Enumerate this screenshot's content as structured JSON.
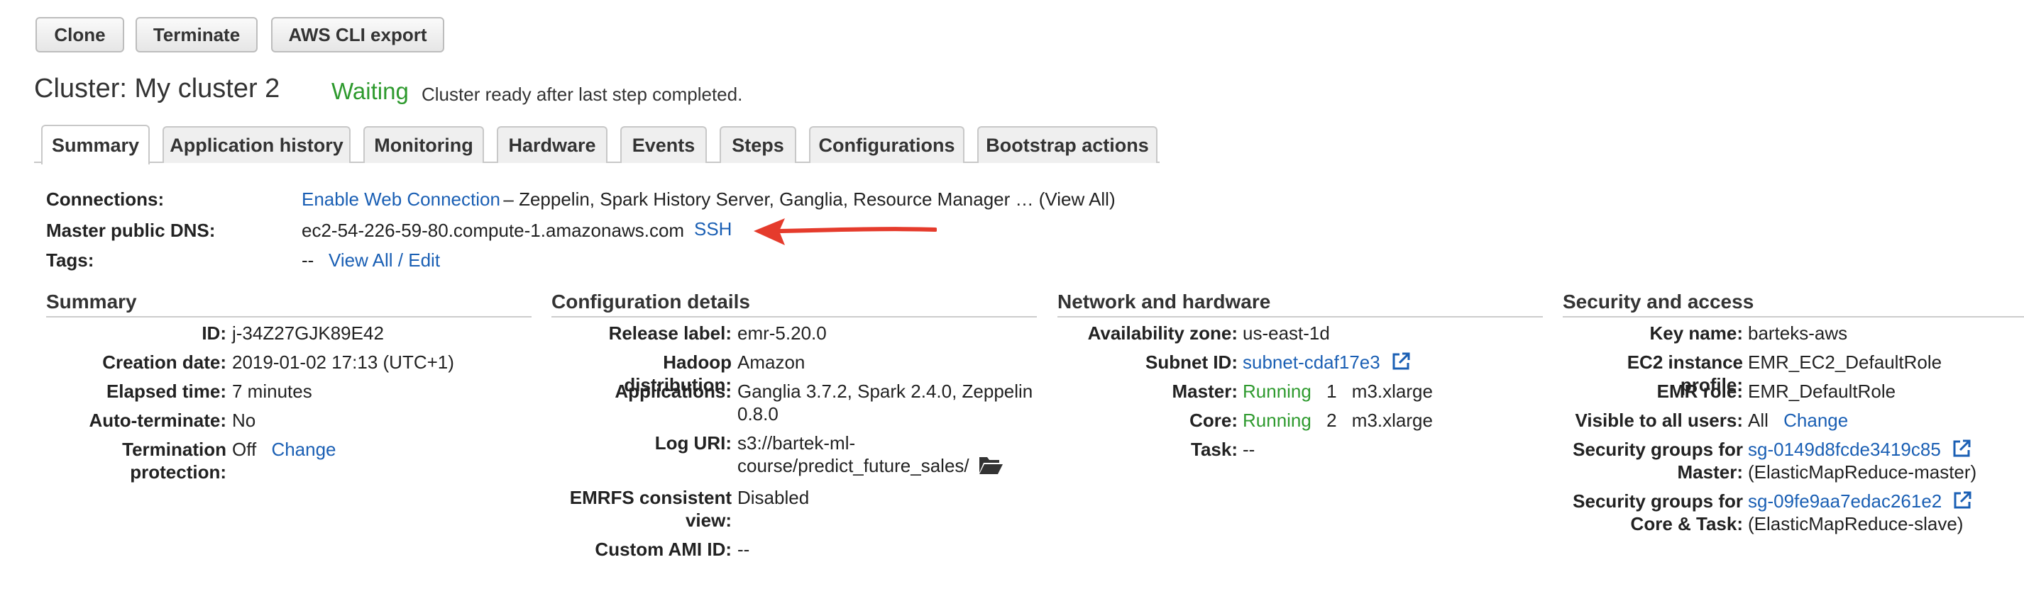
{
  "toolbar": {
    "clone_label": "Clone",
    "terminate_label": "Terminate",
    "cli_export_label": "AWS CLI export"
  },
  "cluster": {
    "title": "Cluster: My cluster 2",
    "status": "Waiting",
    "status_message": "Cluster ready after last step completed."
  },
  "tabs": [
    {
      "label": "Summary",
      "active": true
    },
    {
      "label": "Application history"
    },
    {
      "label": "Monitoring"
    },
    {
      "label": "Hardware"
    },
    {
      "label": "Events"
    },
    {
      "label": "Steps"
    },
    {
      "label": "Configurations"
    },
    {
      "label": "Bootstrap actions"
    }
  ],
  "overview": {
    "connections_label": "Connections:",
    "connections_link": "Enable Web Connection",
    "connections_text": "– Zeppelin, Spark History Server, Ganglia, Resource Manager … (View All)",
    "dns_label": "Master public DNS:",
    "dns_value": "ec2-54-226-59-80.compute-1.amazonaws.com",
    "ssh_link": "SSH",
    "tags_label": "Tags:",
    "tags_value": "--",
    "tags_link": "View All / Edit"
  },
  "summary": {
    "heading": "Summary",
    "id_label": "ID:",
    "id_value": "j-34Z27GJK89E42",
    "created_label": "Creation date:",
    "created_value": "2019-01-02 17:13 (UTC+1)",
    "elapsed_label": "Elapsed time:",
    "elapsed_value": "7 minutes",
    "autoterm_label": "Auto-terminate:",
    "autoterm_value": "No",
    "termprot_label": "Termination protection:",
    "termprot_value": "Off",
    "termprot_link": "Change"
  },
  "config": {
    "heading": "Configuration details",
    "release_label": "Release label:",
    "release_value": "emr-5.20.0",
    "hadoop_label": "Hadoop distribution:",
    "hadoop_value": "Amazon",
    "apps_label": "Applications:",
    "apps_line1": "Ganglia 3.7.2, Spark 2.4.0, Zeppelin",
    "apps_line2": "0.8.0",
    "log_label": "Log URI:",
    "log_line1": "s3://bartek-ml-",
    "log_line2": "course/predict_future_sales/",
    "emrfs_label": "EMRFS consistent view:",
    "emrfs_value": "Disabled",
    "ami_label": "Custom AMI ID:",
    "ami_value": "--"
  },
  "network": {
    "heading": "Network and hardware",
    "az_label": "Availability zone:",
    "az_value": "us-east-1d",
    "subnet_label": "Subnet ID:",
    "subnet_link": "subnet-cdaf17e3",
    "master_label": "Master:",
    "master_status": "Running",
    "master_count": "1",
    "master_type": "m3.xlarge",
    "core_label": "Core:",
    "core_status": "Running",
    "core_count": "2",
    "core_type": "m3.xlarge",
    "task_label": "Task:",
    "task_value": "--"
  },
  "security": {
    "heading": "Security and access",
    "key_label": "Key name:",
    "key_value": "barteks-aws",
    "profile_label": "EC2 instance profile:",
    "profile_value": "EMR_EC2_DefaultRole",
    "role_label": "EMR role:",
    "role_value": "EMR_DefaultRole",
    "visible_label": "Visible to all users:",
    "visible_value": "All",
    "visible_link": "Change",
    "sg_master_label1": "Security groups for",
    "sg_master_label2": "Master:",
    "sg_master_link": "sg-0149d8fcde3419c85",
    "sg_master_name": "(ElasticMapReduce-master)",
    "sg_core_label1": "Security groups for",
    "sg_core_label2": "Core & Task:",
    "sg_core_link": "sg-09fe9aa7edac261e2",
    "sg_core_name": "(ElasticMapReduce-slave)"
  },
  "colors": {
    "link": "#1a5fb4",
    "status_green": "#2e9a2e",
    "arrow_red": "#e53b2c"
  },
  "icons": [
    "external-link-icon",
    "folder-open-icon",
    "red-arrow-annotation"
  ]
}
